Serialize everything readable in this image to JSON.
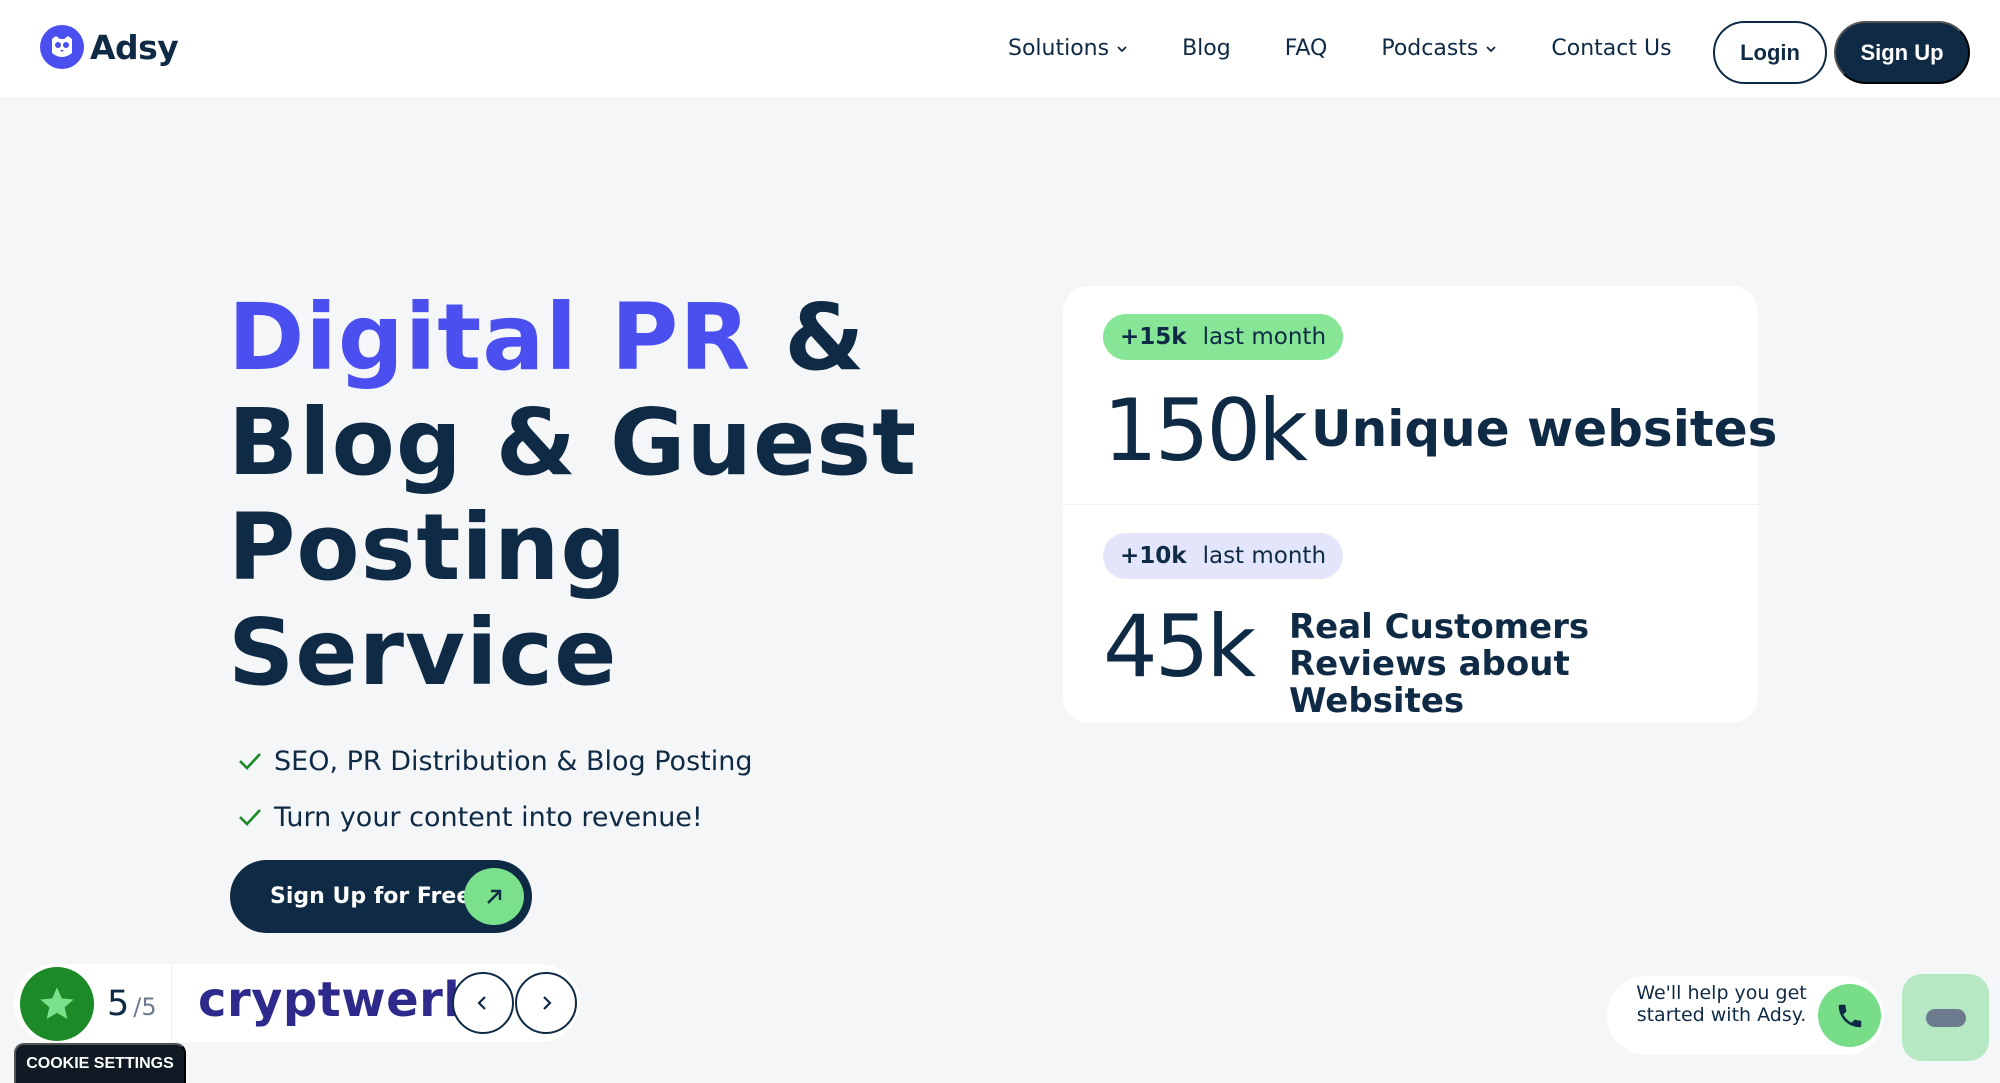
{
  "brand": {
    "name": "Adsy",
    "primary_color": "#4b4ff0",
    "dark_color": "#0f2a44",
    "green_color": "#7be08b"
  },
  "nav": {
    "items": [
      {
        "label": "Solutions",
        "has_dropdown": true
      },
      {
        "label": "Blog",
        "has_dropdown": false
      },
      {
        "label": "FAQ",
        "has_dropdown": false
      },
      {
        "label": "Podcasts",
        "has_dropdown": true
      },
      {
        "label": "Contact Us",
        "has_dropdown": false
      }
    ],
    "login_label": "Login",
    "signup_label": "Sign Up"
  },
  "hero": {
    "title_accent": "Digital PR",
    "title_amp": "&",
    "title_line2": "Blog & Guest",
    "title_line3": "Posting",
    "title_line4": "Service",
    "checks": [
      "SEO, PR Distribution & Blog Posting",
      "Turn your content into revenue!"
    ],
    "cta_label": "Sign Up for Free"
  },
  "stats": [
    {
      "delta": "+15k",
      "period": "last month",
      "value": "150k",
      "label": "Unique websites"
    },
    {
      "delta": "+10k",
      "period": "last month",
      "value": "45k",
      "label": "Real Customers Reviews about Websites"
    }
  ],
  "review": {
    "score": "5",
    "score_of": "/5",
    "brand": "cryptwerk"
  },
  "cookie_label": "COOKIE SETTINGS",
  "help": {
    "text": "We'll help you get started with Adsy."
  }
}
